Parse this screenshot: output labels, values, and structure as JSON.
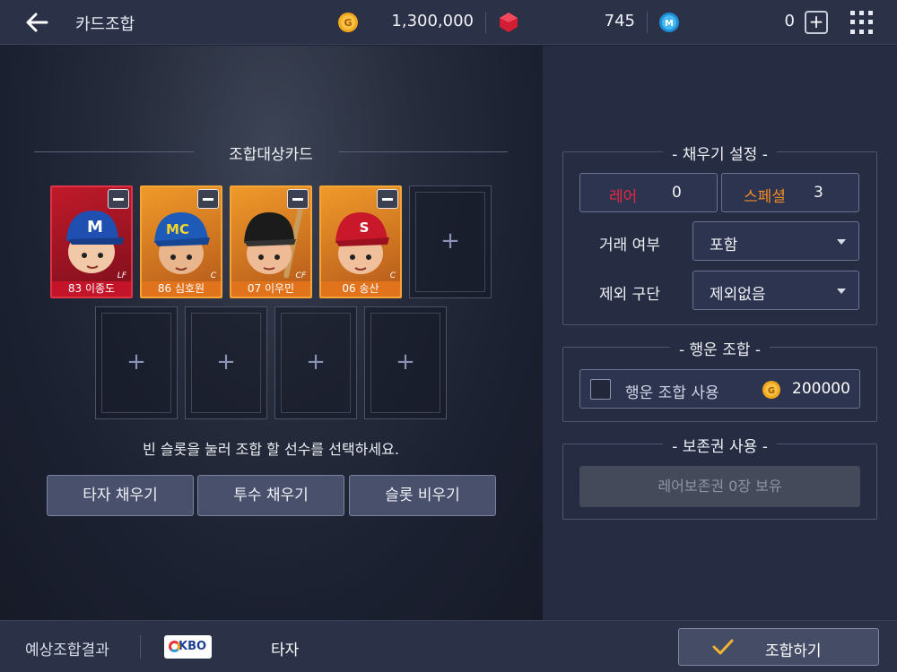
{
  "topbar": {
    "title": "카드조합",
    "gold": "1,300,000",
    "gems": "745",
    "mpoints": "0",
    "plus": "+"
  },
  "left": {
    "section_title": "조합대상카드",
    "cards": [
      {
        "name": "83 이종도",
        "position": "LF",
        "grade": "red",
        "cap_color": "#1f4fb0",
        "cap_text": "M"
      },
      {
        "name": "86 심호원",
        "position": "C",
        "grade": "orange",
        "cap_color": "#1e5bb8",
        "cap_text": "MC"
      },
      {
        "name": "07 이우민",
        "position": "CF",
        "grade": "orange",
        "cap_color": "#1a1a1a",
        "cap_text": ""
      },
      {
        "name": "06 송산",
        "position": "C",
        "grade": "orange",
        "cap_color": "#c8182a",
        "cap_text": "S"
      }
    ],
    "empty_plus": "+",
    "hint": "빈 슬롯을 눌러 조합 할 선수를 선택하세요.",
    "buttons": {
      "fill_batter": "타자 채우기",
      "fill_pitcher": "투수 채우기",
      "clear_slots": "슬롯 비우기"
    }
  },
  "right": {
    "fill_settings": {
      "title": "채우기 설정",
      "rare_label": "레어",
      "rare_count": "0",
      "special_label": "스페셜",
      "special_count": "3",
      "trade_label": "거래 여부",
      "trade_value": "포함",
      "exclude_label": "제외 구단",
      "exclude_value": "제외없음"
    },
    "luck": {
      "title": "행운 조합",
      "use_label": "행운 조합 사용",
      "cost": "200000"
    },
    "keep": {
      "title": "보존권 사용",
      "status": "레어보존권 0장 보유"
    }
  },
  "bottom": {
    "result_label": "예상조합결과",
    "league": "KBO",
    "type": "타자",
    "combine": "조합하기"
  },
  "colors": {
    "rare": "#e8293d",
    "special": "#f08a24",
    "gold": "#f2a81d"
  }
}
